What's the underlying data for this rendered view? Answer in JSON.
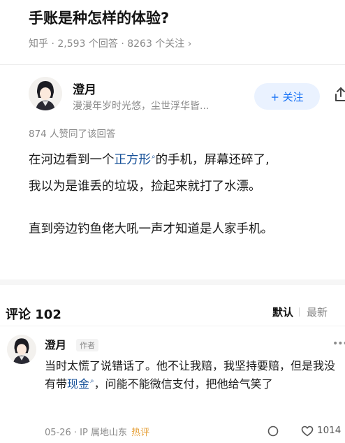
{
  "question": {
    "title": "手账是种怎样的体验?",
    "meta": "知乎 · 2,593 个回答 · 8263 个关注 ›"
  },
  "author": {
    "name": "澄月",
    "bio": "漫漫年岁时光悠，尘世浮华皆...",
    "follow_label": "+ 关注"
  },
  "answer": {
    "votes": "874 人赞同了该回答",
    "line1_before": "在河边看到一个",
    "line1_link": "正方形",
    "line1_after": "的手机，屏幕还碎了,",
    "line2": "我以为是谁丢的垃圾，捡起来就打了水漂。",
    "line3": "直到旁边钓鱼佬大吼一声才知道是人家手机。"
  },
  "comments": {
    "header": "评论 102",
    "sort_default": "默认",
    "sort_new": "最新",
    "item": {
      "name": "澄月",
      "tag": "作者",
      "text_before": "当时太慌了说错话了。他不让我赔，我坚持要赔，但是我没有带",
      "text_link": "现金",
      "text_after": "，问能不能微信支付，把他给气笑了",
      "meta": "05-26 · IP 属地山东",
      "hot": "热评",
      "likes": "1014"
    }
  },
  "icons": {
    "link_search": "search-icon",
    "share": "share-icon",
    "reply": "comment-icon",
    "like": "heart-icon",
    "more": "more-icon"
  },
  "colors": {
    "accent": "#1772f6",
    "link": "#175199",
    "hot": "#e6a23c"
  }
}
